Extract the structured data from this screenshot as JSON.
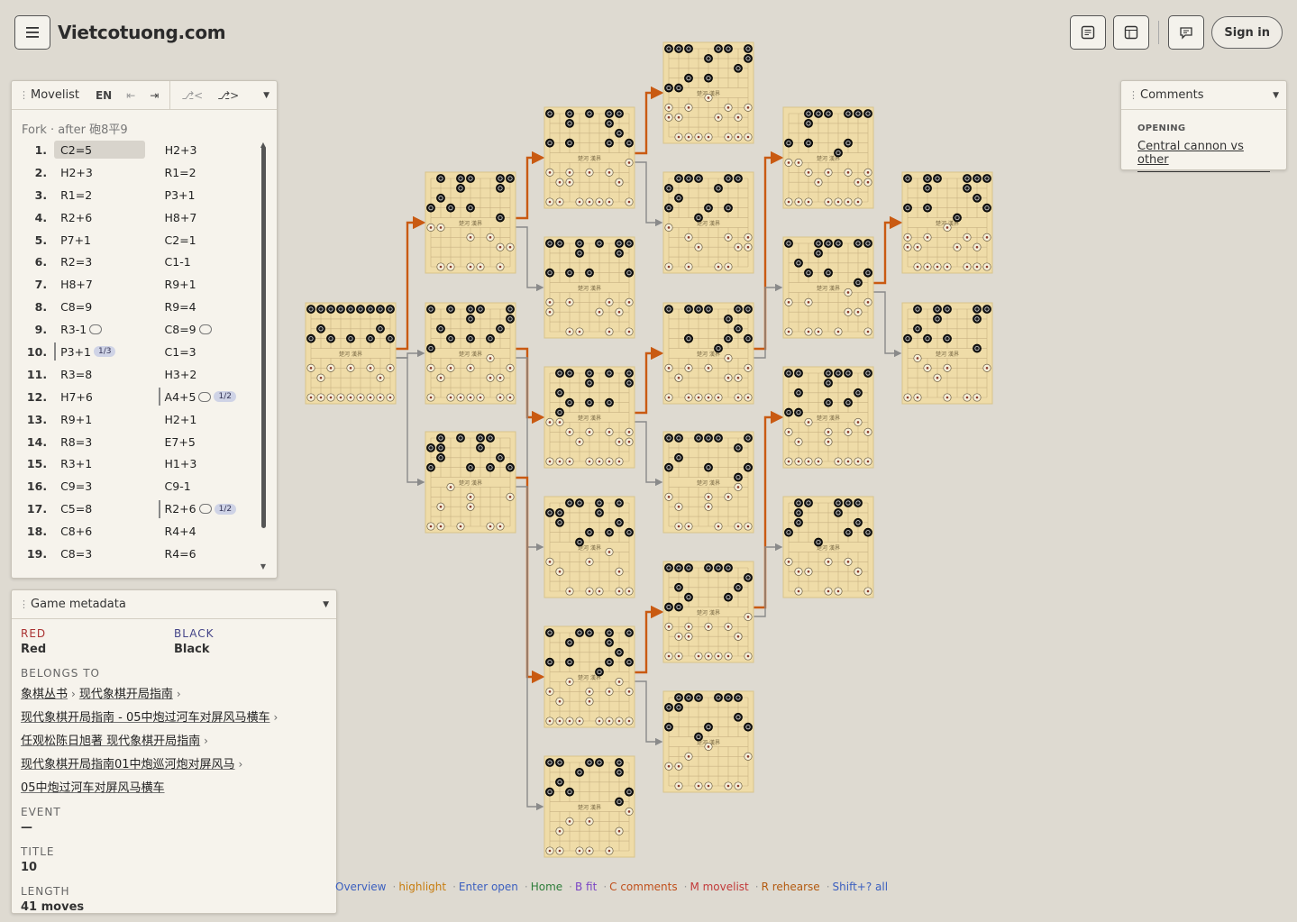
{
  "app": {
    "title": "Vietcotuong.com",
    "sign_in": "Sign in"
  },
  "header_icons": [
    "menu-icon",
    "document-icon",
    "board-layout-icon",
    "comment-icon"
  ],
  "movelist": {
    "title": "Movelist",
    "lang": "EN",
    "fork_label": "Fork · after 砲8平9",
    "rows": [
      {
        "no": "1.",
        "red": "C2=5",
        "black": "H2+3"
      },
      {
        "no": "2.",
        "red": "H2+3",
        "black": "R1=2"
      },
      {
        "no": "3.",
        "red": "R1=2",
        "black": "P3+1"
      },
      {
        "no": "4.",
        "red": "R2+6",
        "black": "H8+7"
      },
      {
        "no": "5.",
        "red": "P7+1",
        "black": "C2=1"
      },
      {
        "no": "6.",
        "red": "R2=3",
        "black": "C1-1"
      },
      {
        "no": "7.",
        "red": "H8+7",
        "black": "R9+1"
      },
      {
        "no": "8.",
        "red": "C8=9",
        "black": "R9=4"
      },
      {
        "no": "9.",
        "red": "R3-1",
        "black": "C8=9"
      },
      {
        "no": "10.",
        "red": "P3+1",
        "black": "C1=3"
      },
      {
        "no": "11.",
        "red": "R3=8",
        "black": "H3+2"
      },
      {
        "no": "12.",
        "red": "H7+6",
        "black": "A4+5"
      },
      {
        "no": "13.",
        "red": "R9+1",
        "black": "H2+1"
      },
      {
        "no": "14.",
        "red": "R8=3",
        "black": "E7+5"
      },
      {
        "no": "15.",
        "red": "R3+1",
        "black": "H1+3"
      },
      {
        "no": "16.",
        "red": "C9=3",
        "black": "C9-1"
      },
      {
        "no": "17.",
        "red": "C5=8",
        "black": "R2+6"
      },
      {
        "no": "18.",
        "red": "C8+6",
        "black": "R4+4"
      },
      {
        "no": "19.",
        "red": "C8=3",
        "black": "R4=6"
      }
    ],
    "badges": {
      "r10": "1/3",
      "b12": "1/2",
      "b17": "1/2"
    }
  },
  "metadata": {
    "title": "Game metadata",
    "red_label": "RED",
    "red_value": "Red",
    "black_label": "BLACK",
    "black_value": "Black",
    "belongs_label": "BELONGS TO",
    "crumbs": [
      "象棋丛书",
      "现代象棋开局指南",
      "现代象棋开局指南 - 05中炮过河车对屏风马横车",
      "任观松陈日旭著 现代象棋开局指南",
      "现代象棋开局指南01中炮巡河炮对屏风马",
      "05中炮过河车对屏风马横车"
    ],
    "event_label": "EVENT",
    "event_value": "—",
    "title_label": "TITLE",
    "title_value": "10",
    "length_label": "LENGTH",
    "length_value": "41 moves"
  },
  "comments": {
    "title": "Comments",
    "opening_label": "OPENING",
    "opening_value": "Central cannon vs other"
  },
  "shortcuts": [
    {
      "text": "Overview",
      "color": "#3b5fbf"
    },
    {
      "text": "highlight",
      "color": "#c77d10"
    },
    {
      "text": "Enter open",
      "color": "#3b5fbf"
    },
    {
      "text": "Home",
      "color": "#2d7d3a"
    },
    {
      "text": "B fit",
      "color": "#7a45c4"
    },
    {
      "text": "C comments",
      "color": "#c0501c"
    },
    {
      "text": "M movelist",
      "color": "#c23a3a"
    },
    {
      "text": "R rehearse",
      "color": "#b35a10"
    },
    {
      "text": "Shift+? all",
      "color": "#3b5fbf"
    }
  ],
  "board_river": "楚河 漢界",
  "colors": {
    "accent": "#c95a12",
    "board": "#efdca8",
    "edge": "#8a8a8a"
  }
}
